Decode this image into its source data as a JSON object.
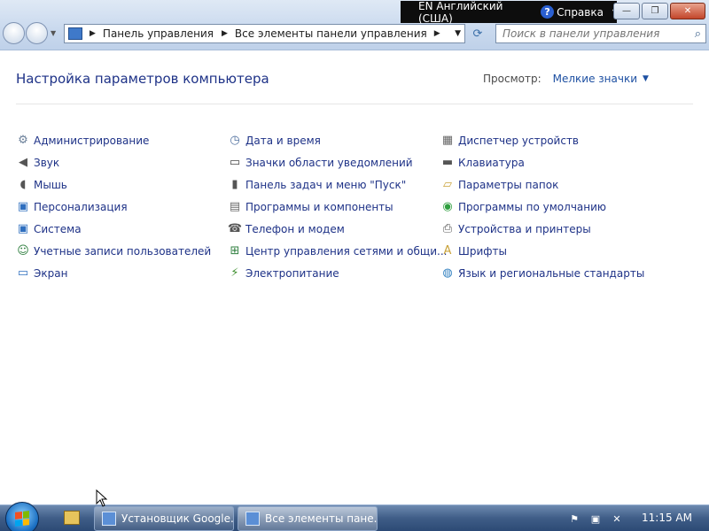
{
  "window": {
    "lang_indicator": "EN Английский (США)",
    "help_label": "Справка",
    "buttons": {
      "minimize": "—",
      "maximize": "❐",
      "close": "✕"
    }
  },
  "nav": {
    "address_parts": [
      "Панель управления",
      "Все элементы панели управления"
    ],
    "search_placeholder": "Поиск в панели управления"
  },
  "main": {
    "title": "Настройка параметров компьютера",
    "view_label": "Просмотр:",
    "view_value": "Мелкие значки",
    "columns": [
      [
        {
          "label": "Администрирование",
          "icon": "admin-tools-icon"
        },
        {
          "label": "Звук",
          "icon": "speaker-icon"
        },
        {
          "label": "Мышь",
          "icon": "mouse-icon"
        },
        {
          "label": "Персонализация",
          "icon": "personalization-icon"
        },
        {
          "label": "Система",
          "icon": "system-icon"
        },
        {
          "label": "Учетные записи пользователей",
          "icon": "users-icon"
        },
        {
          "label": "Экран",
          "icon": "display-icon"
        }
      ],
      [
        {
          "label": "Дата и время",
          "icon": "clock-icon"
        },
        {
          "label": "Значки области уведомлений",
          "icon": "notification-icons-icon"
        },
        {
          "label": "Панель задач и меню \"Пуск\"",
          "icon": "taskbar-icon"
        },
        {
          "label": "Программы и компоненты",
          "icon": "programs-icon"
        },
        {
          "label": "Телефон и модем",
          "icon": "phone-modem-icon"
        },
        {
          "label": "Центр управления сетями и общи...",
          "icon": "network-icon"
        },
        {
          "label": "Электропитание",
          "icon": "power-icon"
        }
      ],
      [
        {
          "label": "Диспетчер устройств",
          "icon": "device-manager-icon"
        },
        {
          "label": "Клавиатура",
          "icon": "keyboard-icon"
        },
        {
          "label": "Параметры папок",
          "icon": "folder-options-icon"
        },
        {
          "label": "Программы по умолчанию",
          "icon": "default-programs-icon"
        },
        {
          "label": "Устройства и принтеры",
          "icon": "printer-icon"
        },
        {
          "label": "Шрифты",
          "icon": "fonts-icon"
        },
        {
          "label": "Язык и региональные стандарты",
          "icon": "region-icon"
        }
      ]
    ]
  },
  "taskbar": {
    "buttons": [
      {
        "label": "Установщик Google..."
      },
      {
        "label": "Все элементы пане..."
      }
    ],
    "clock": "11:15 AM"
  }
}
